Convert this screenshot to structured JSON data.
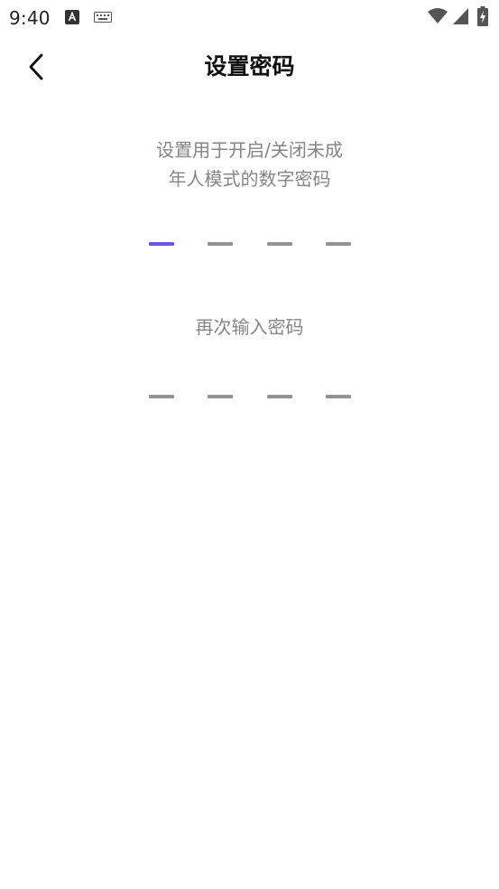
{
  "status_bar": {
    "time": "9:40",
    "icons": [
      "text-input-icon",
      "keyboard-icon",
      "wifi-icon",
      "signal-icon",
      "battery-charging-icon"
    ]
  },
  "header": {
    "back_icon": "chevron-left-icon",
    "title": "设置密码"
  },
  "instruction": {
    "line1": "设置用于开启/关闭未成",
    "line2": "年人模式的数字密码"
  },
  "pin_first": {
    "length": 4,
    "active_index": 0
  },
  "repeat": {
    "label": "再次输入密码"
  },
  "pin_second": {
    "length": 4
  },
  "colors": {
    "accent": "#6a58d9",
    "slot": "#939393",
    "hint_text": "#858585",
    "title_text": "#111111"
  }
}
